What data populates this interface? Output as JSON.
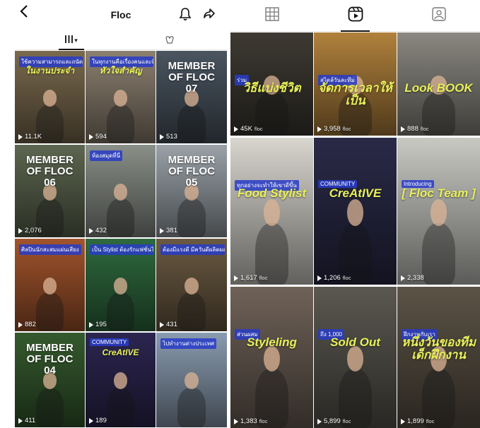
{
  "profile": {
    "back_icon": "chevron-left-icon",
    "title": "Floc",
    "bell_icon": "bell-icon",
    "share_icon": "share-icon"
  },
  "left_tabs": [
    {
      "icon": "grid-icon",
      "label": "▾"
    },
    {
      "icon": "tagged-heart-icon",
      "label": ""
    }
  ],
  "right_tabs": [
    {
      "icon": "grid-icon"
    },
    {
      "icon": "reels-icon"
    },
    {
      "icon": "tagged-user-icon"
    }
  ],
  "left_posts": [
    {
      "headline_small": "ใช้ความสามารถและถนัด ดีที่",
      "headline": "ในงานประจำ",
      "count": "11.1K",
      "bg": "#7a6a4e"
    },
    {
      "headline": "หัวใจสำคัญ",
      "headline_small": "ในทุกงานคือเรื่องคนและทีม",
      "count": "594",
      "bg": "#8c8070"
    },
    {
      "headline": "MEMBER OF FLOC 07",
      "count": "513",
      "bg": "#4a5560"
    },
    {
      "headline": "MEMBER OF FLOC 06",
      "count": "2,076",
      "bg": "#5d6650"
    },
    {
      "headline_small": "ห้องสมุดที่นี่",
      "count": "432",
      "bg": "#8a8f88"
    },
    {
      "headline": "MEMBER OF FLOC 05",
      "count": "381",
      "bg": "#9aa2a8"
    },
    {
      "headline_small": "ศิลปินนักสะสมแผ่นเสียง",
      "count": "882",
      "bg": "#a2542c"
    },
    {
      "headline_small": "เป็น Stylist ต้องรักแฟชั่นไหม?",
      "count": "195",
      "bg": "#2f6a3f"
    },
    {
      "headline_small": "ต้องมีแรงดี มีควันดีผลิตผล",
      "count": "431",
      "bg": "#6b5a42"
    },
    {
      "headline": "MEMBER OF FLOC 04",
      "count": "411",
      "bg": "#355a2e"
    },
    {
      "headline": "CreAtIVE",
      "headline_small": "COMMUNITY",
      "count": "189",
      "bg": "#2c2650"
    },
    {
      "headline_small": "ไปทำงานต่างประเทศ",
      "count": "",
      "bg": "#8a9cb0"
    }
  ],
  "right_posts": [
    {
      "headline": "วิธีแบ่งชีวิต",
      "headline_small": "ร่วม",
      "count": "45K",
      "tag": "floc",
      "bg": "#3e3a33"
    },
    {
      "headline": "จัดการเวลาให้เป็น",
      "headline_small": "สไตล์วันละทีม",
      "count": "3,958",
      "tag": "floc",
      "bg": "#b0813c"
    },
    {
      "headline": "Look BOOK",
      "count": "888",
      "tag": "floc",
      "bg": "#8a8880"
    },
    {
      "headline": "Food Stylist",
      "headline_small": "ทุกอย่างจะทำให้เขาดีขึ้น",
      "count": "1,617",
      "tag": "floc",
      "bg": "#d9d6cf"
    },
    {
      "headline": "CreAtIVE",
      "headline_small": "COMMUNITY",
      "count": "1,206",
      "tag": "floc",
      "bg": "#2a2a48"
    },
    {
      "headline": "[ Floc Team ]",
      "headline_small": "Introducing",
      "count": "2,338",
      "tag": "",
      "bg": "#c9c9c4"
    },
    {
      "headline": "Styleling",
      "headline_small": "ส่วนผสม",
      "count": "1,383",
      "tag": "floc",
      "bg": "#6f6258"
    },
    {
      "headline": "Sold Out",
      "headline_small": "ถึง 1,000",
      "count": "5,899",
      "tag": "floc",
      "bg": "#5a5850"
    },
    {
      "headline": "หนึ่งวันของทีมเด็กฝึกงาน",
      "headline_small": "ฝึกงานกับเรา",
      "count": "1,899",
      "tag": "floc",
      "bg": "#5c5346"
    }
  ],
  "colors": {
    "accent_lime": "#e8f05a",
    "text": "#111111",
    "divider": "#e3e3e3"
  }
}
